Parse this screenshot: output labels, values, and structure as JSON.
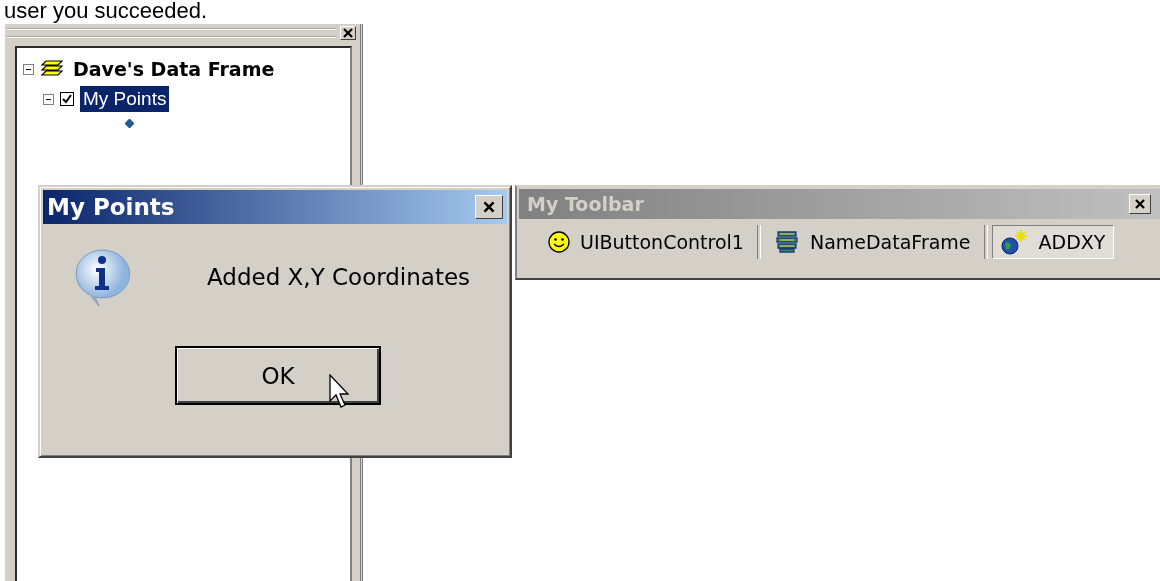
{
  "caption": "user you succeeded.",
  "toc_window": {
    "tree": [
      {
        "label": "Dave's Data Frame",
        "expanded": true,
        "selected": false,
        "children": [
          {
            "label": "My Points",
            "expanded": true,
            "checked": true,
            "selected": true
          }
        ]
      }
    ]
  },
  "message_box": {
    "title": "My Points",
    "message": "Added X,Y Coordinates",
    "buttons": [
      "OK"
    ]
  },
  "toolbar": {
    "title": "My Toolbar",
    "buttons": [
      {
        "label": "UIButtonControl1",
        "pressed": false
      },
      {
        "label": "NameDataFrame",
        "pressed": false
      },
      {
        "label": "ADDXY",
        "pressed": true
      }
    ]
  }
}
